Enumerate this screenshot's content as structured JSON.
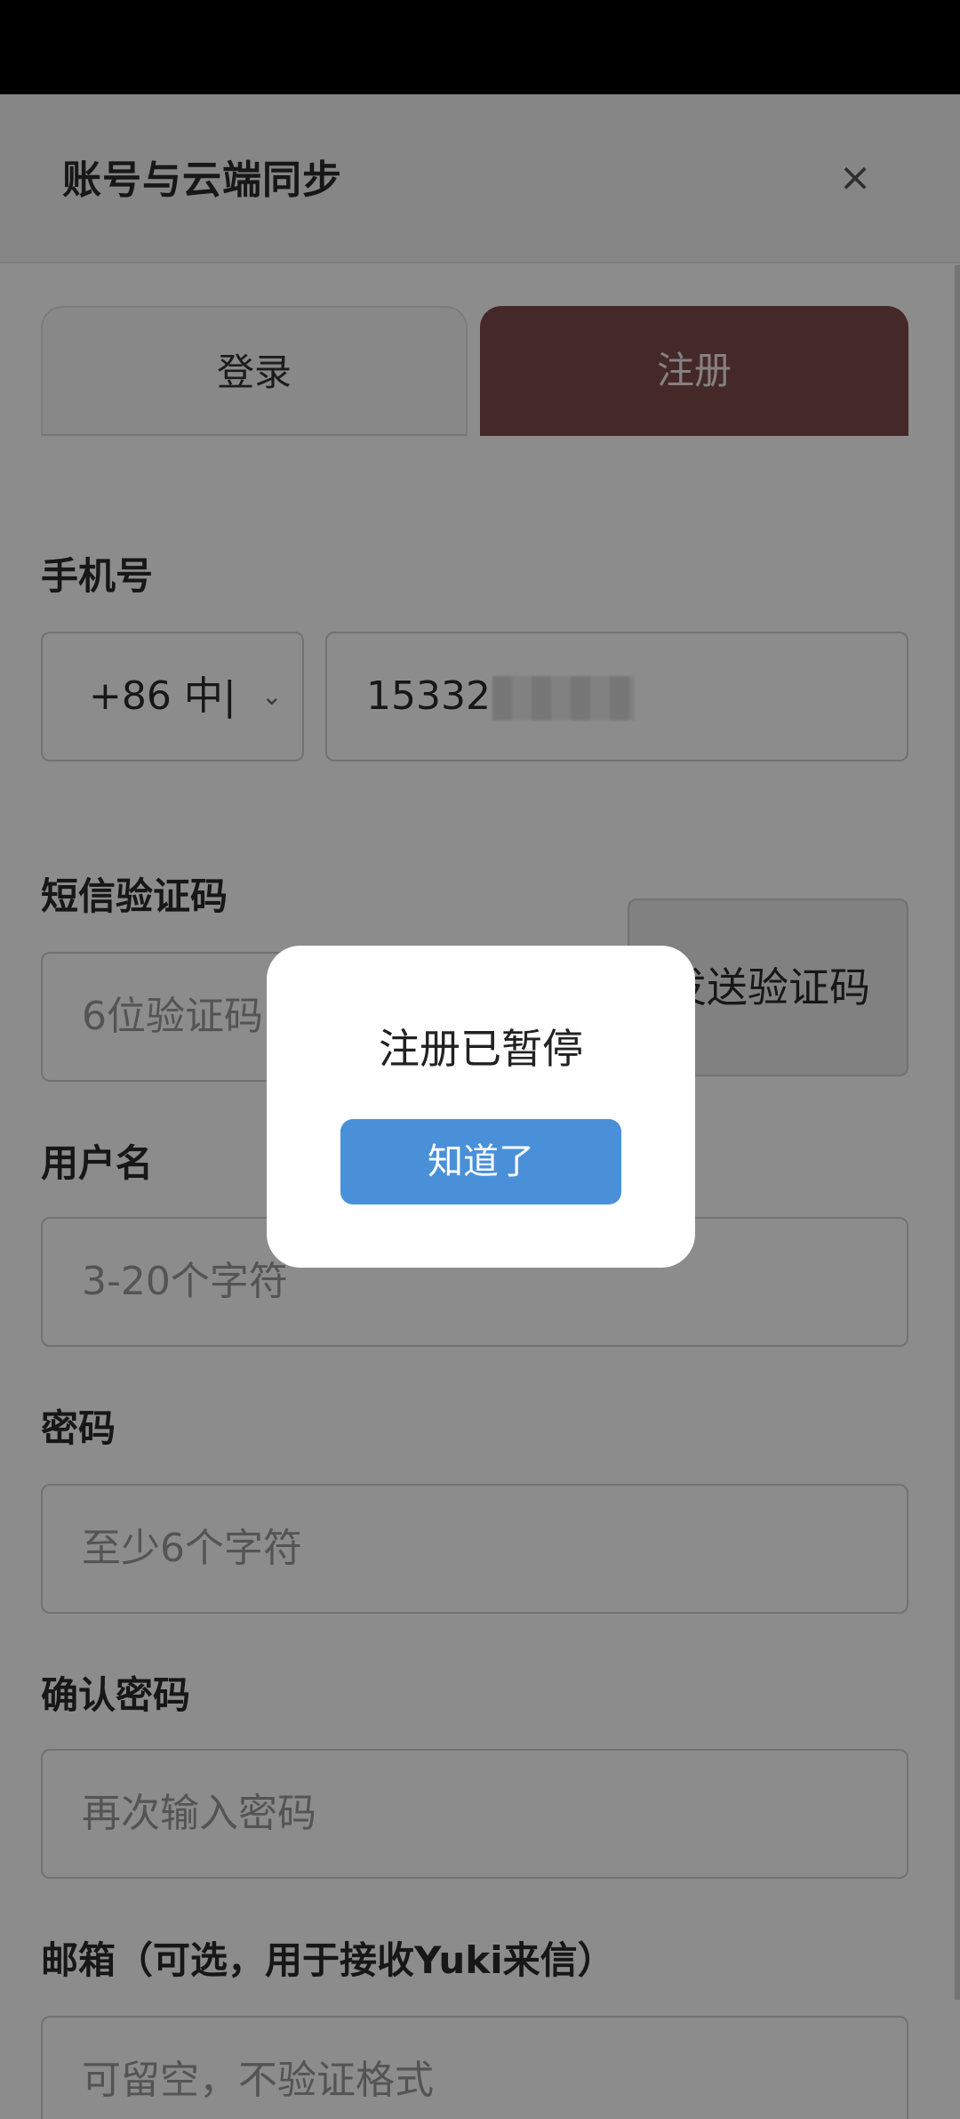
{
  "header": {
    "title": "账号与云端同步",
    "close_label": "×"
  },
  "tabs": [
    {
      "label": "登录",
      "active": false
    },
    {
      "label": "注册",
      "active": true
    }
  ],
  "form": {
    "phone": {
      "label": "手机号",
      "country_code": "+86 中|",
      "value": "15332"
    },
    "sms": {
      "label": "短信验证码",
      "placeholder": "6位验证码",
      "send_button": "发送验证码"
    },
    "username": {
      "label": "用户名",
      "placeholder": "3-20个字符"
    },
    "password": {
      "label": "密码",
      "placeholder": "至少6个字符"
    },
    "confirm_password": {
      "label": "确认密码",
      "placeholder": "再次输入密码"
    },
    "email": {
      "label": "邮箱（可选，用于接收Yuki来信）",
      "placeholder": "可留空，不验证格式"
    }
  },
  "dialog": {
    "message": "注册已暂停",
    "confirm_button": "知道了"
  },
  "colors": {
    "active_tab": "#7e4a4a",
    "dialog_button": "#4a90d9"
  }
}
